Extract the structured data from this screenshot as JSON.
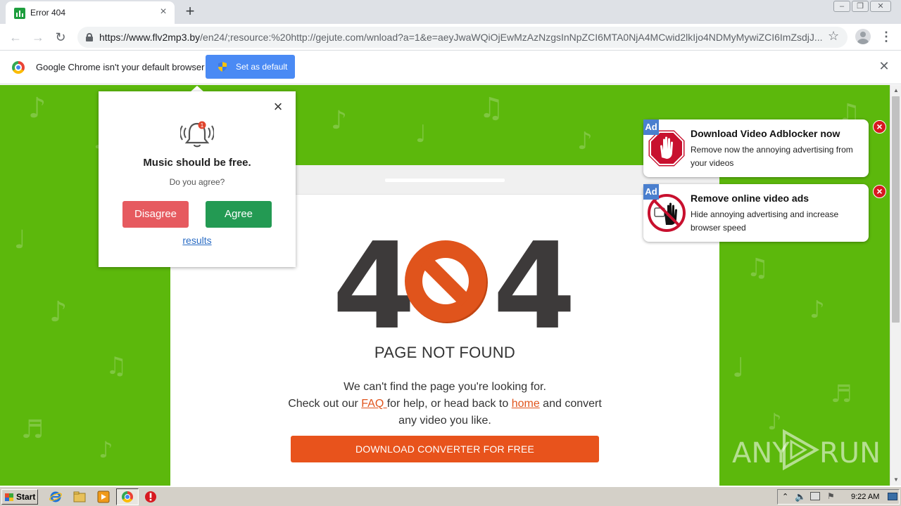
{
  "browser": {
    "tab_title": "Error 404",
    "url_host": "https://www.flv2mp3.by",
    "url_rest": "/en24/;resource:%20http://gejute.com/wnload?a=1&e=aeyJwaWQiOjEwMzAzNzgsInNpZCI6MTA0NjA4MCwid2lkIjo4NDMyMywiZCI6ImZsdjJ..."
  },
  "infobar": {
    "message": "Google Chrome isn't your default browser",
    "set_default_label": "Set as default"
  },
  "popup": {
    "title": "Music should be free.",
    "subtitle": "Do you agree?",
    "disagree_label": "Disagree",
    "agree_label": "Agree",
    "results_link": "results",
    "bell_badge": "1"
  },
  "error_page": {
    "digit_left": "4",
    "digit_right": "4",
    "heading": "PAGE NOT FOUND",
    "line1": "We can't find the page you're looking for.",
    "line2_pre": "Check out our ",
    "faq_link": "FAQ ",
    "line2_mid": "for help, or head back to ",
    "home_link": "home",
    "line2_post": " and convert",
    "line3": "any video you like.",
    "download_label": "DOWNLOAD CONVERTER FOR FREE"
  },
  "ads": [
    {
      "badge": "Ad",
      "title": "Download Video Adblocker now",
      "description": "Remove now the annoying advertising from your videos"
    },
    {
      "badge": "Ad",
      "title": "Remove online video ads",
      "description": "Hide annoying advertising and increase browser speed"
    }
  ],
  "watermark": {
    "left": "ANY",
    "right": "RUN"
  },
  "taskbar": {
    "start_label": "Start",
    "clock": "9:22 AM"
  },
  "colors": {
    "page_green": "#5cb80c",
    "accent_orange": "#e8531c",
    "agree_green": "#239a53",
    "disagree_red": "#e65a5f",
    "chrome_blue": "#4a8af4"
  }
}
